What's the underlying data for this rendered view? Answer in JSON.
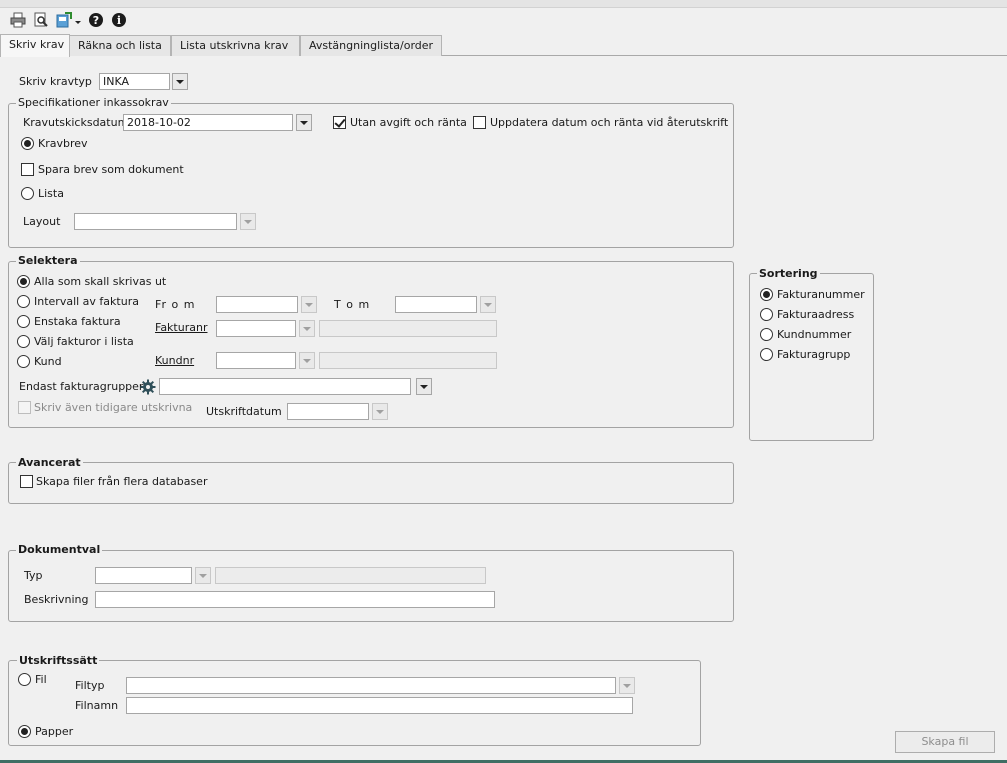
{
  "toolbar": {
    "icons": [
      "printer-icon",
      "print-preview-icon",
      "export-icon",
      "help-icon",
      "info-icon"
    ]
  },
  "tabs": [
    {
      "label": "Skriv krav",
      "active": true
    },
    {
      "label": "Räkna och lista",
      "active": false
    },
    {
      "label": "Lista utskrivna krav",
      "active": false
    },
    {
      "label": "Avstängninglista/order",
      "active": false
    }
  ],
  "kravtyp": {
    "label": "Skriv kravtyp",
    "value": "INKA"
  },
  "spec": {
    "title": "Specifikationer inkassokrav",
    "date_label": "Kravutskicksdatum",
    "date_value": "2018-10-02",
    "utan_avgift": "Utan avgift och ränta",
    "uppdatera": "Uppdatera datum och ränta vid återutskrift",
    "kravbrev": "Kravbrev",
    "spara_brev": "Spara brev som dokument",
    "lista": "Lista",
    "layout_label": "Layout",
    "layout_value": ""
  },
  "selektera": {
    "title": "Selektera",
    "alla": "Alla som skall skrivas ut",
    "intervall": "Intervall av faktura",
    "enstaka": "Enstaka faktura",
    "valj": "Välj fakturor i lista",
    "kund": "Kund",
    "from": "Fr o m",
    "tom": "T o m",
    "fakturanr": "Fakturanr",
    "kundnr": "Kundnr",
    "fakturagrupper": "Endast fakturagrupper",
    "tidigare": "Skriv även tidigare utskrivna",
    "utskriftdatum": "Utskriftdatum"
  },
  "sortering": {
    "title": "Sortering",
    "options": [
      "Fakturanummer",
      "Fakturaadress",
      "Kundnummer",
      "Fakturagrupp"
    ],
    "selected": 0
  },
  "avancerat": {
    "title": "Avancerat",
    "skapa_filer": "Skapa filer från flera databaser"
  },
  "dokumentval": {
    "title": "Dokumentval",
    "typ": "Typ",
    "beskrivning": "Beskrivning"
  },
  "utskriftssatt": {
    "title": "Utskriftssätt",
    "fil": "Fil",
    "filtyp": "Filtyp",
    "filnamn": "Filnamn",
    "papper": "Papper"
  },
  "actions": {
    "skapa_fil": "Skapa fil"
  }
}
